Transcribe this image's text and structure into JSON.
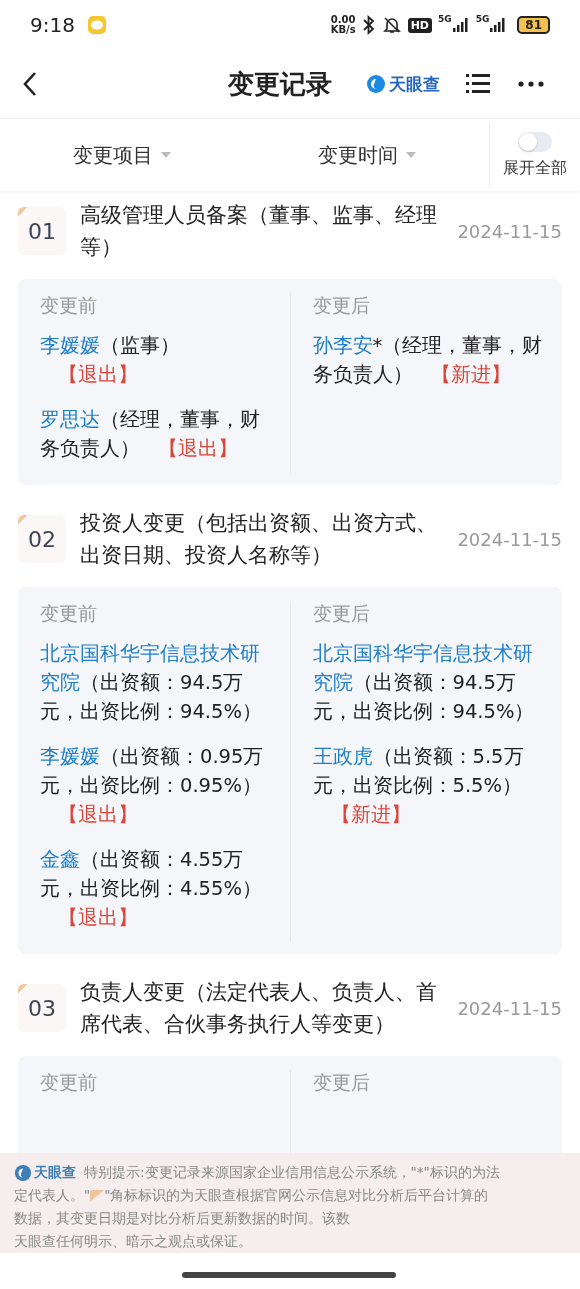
{
  "status_bar": {
    "time": "9:18",
    "net_speed": "0.00",
    "net_unit": "KB/s",
    "hd": "HD",
    "signal_1": "5G",
    "signal_2": "5G",
    "battery": "81"
  },
  "nav": {
    "title": "变更记录",
    "logo_text": "天眼查"
  },
  "filters": [
    {
      "label": "变更项目"
    },
    {
      "label": "变更时间"
    }
  ],
  "expand_all": {
    "label": "展开全部",
    "on": false
  },
  "records": [
    {
      "number": "01",
      "title": "高级管理人员备案（董事、监事、经理等）",
      "date": "2024-11-15",
      "before_label": "变更前",
      "after_label": "变更后",
      "before": [
        {
          "name": "李媛媛",
          "detail": "（监事）",
          "tag": "【退出】"
        },
        {
          "name": "罗思达",
          "detail": "（经理，董事，财务负责人）",
          "tag": "【退出】"
        }
      ],
      "after": [
        {
          "name": "孙李安",
          "detail": "*（经理，董事，财务负责人）",
          "tag": "【新进】"
        }
      ]
    },
    {
      "number": "02",
      "title": "投资人变更（包括出资额、出资方式、出资日期、投资人名称等）",
      "date": "2024-11-15",
      "before_label": "变更前",
      "after_label": "变更后",
      "before": [
        {
          "name": "北京国科华宇信息技术研究院",
          "detail": "（出资额：94.5万元，出资比例：94.5%）"
        },
        {
          "name": "李媛媛",
          "detail": "（出资额：0.95万元，出资比例：0.95%）",
          "tag": "【退出】"
        },
        {
          "name": "金鑫",
          "detail": "（出资额：4.55万元，出资比例：4.55%）",
          "tag": "【退出】"
        }
      ],
      "after": [
        {
          "name": "北京国科华宇信息技术研究院",
          "detail": "（出资额：94.5万元，出资比例：94.5%）"
        },
        {
          "name": "王政虎",
          "detail": "（出资额：5.5万元，出资比例：5.5%）",
          "tag": "【新进】"
        }
      ]
    },
    {
      "number": "03",
      "title": "负责人变更（法定代表人、负责人、首席代表、合伙事务执行人等变更）",
      "date": "2024-11-15",
      "before_label": "变更前",
      "after_label": "变更后"
    }
  ],
  "notice": {
    "logo_text": "天眼查",
    "lines": [
      "特别提示:变更记录来源国家企业信用信息公示系统，\"*\"标识的为法",
      "定代表人。\"",
      "\"角标标识的为天眼查根据官网公示信息对比分析后平台计算的",
      "数据，其变更日期是对比分析后更新数据的时间。该数",
      "天眼查任何明示、暗示之观点或保证。"
    ]
  }
}
